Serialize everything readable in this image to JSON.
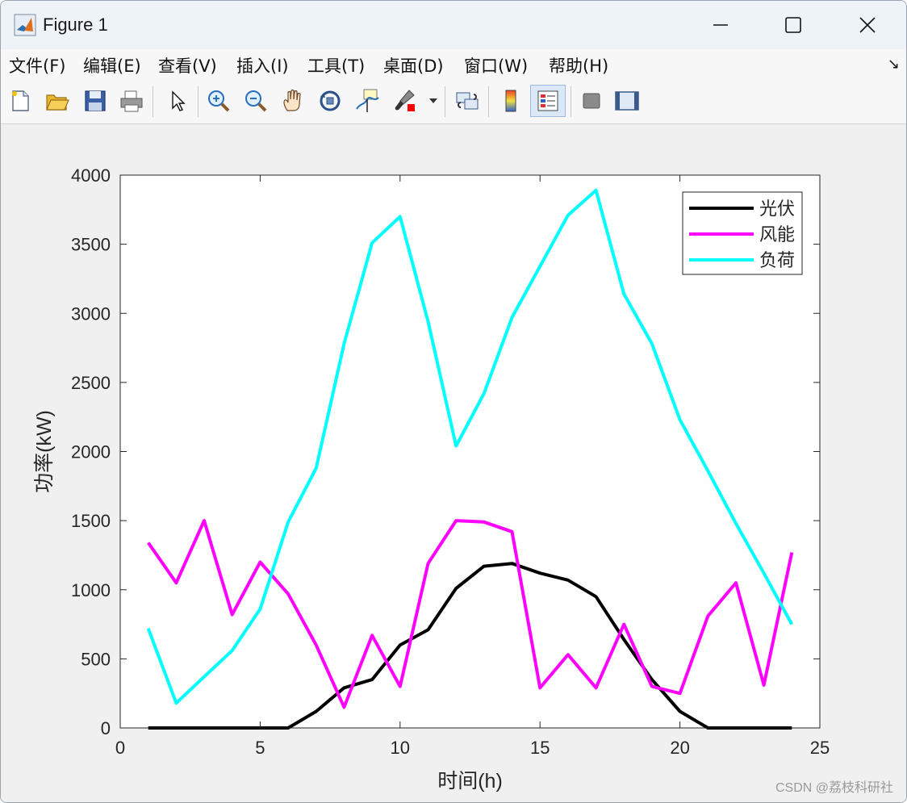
{
  "window": {
    "title": "Figure 1",
    "minimize_glyph": "—",
    "maximize_glyph": "☐",
    "close_glyph": "✕"
  },
  "menu": {
    "items": [
      {
        "label": "文件(F)"
      },
      {
        "label": "编辑(E)"
      },
      {
        "label": "查看(V)"
      },
      {
        "label": "插入(I)"
      },
      {
        "label": "工具(T)"
      },
      {
        "label": "桌面(D)"
      },
      {
        "label": "窗口(W)"
      },
      {
        "label": "帮助(H)"
      }
    ],
    "overflow_glyph": "↘"
  },
  "toolbar": {
    "tools": [
      {
        "icon": "new-figure-icon"
      },
      {
        "icon": "open-file-icon"
      },
      {
        "icon": "save-icon"
      },
      {
        "icon": "print-icon"
      },
      {
        "icon": "pointer-icon"
      },
      {
        "icon": "zoom-in-icon"
      },
      {
        "icon": "zoom-out-icon"
      },
      {
        "icon": "pan-hand-icon"
      },
      {
        "icon": "rotate-3d-icon"
      },
      {
        "icon": "data-cursor-icon"
      },
      {
        "icon": "brush-icon"
      },
      {
        "icon": "link-plot-icon"
      },
      {
        "icon": "colorbar-icon"
      },
      {
        "icon": "legend-icon"
      },
      {
        "icon": "hide-plot-tools-icon"
      },
      {
        "icon": "show-plot-tools-icon"
      }
    ]
  },
  "chart_data": {
    "type": "line",
    "title": "",
    "xlabel": "时间(h)",
    "ylabel": "功率(kW)",
    "xlim": [
      0,
      25
    ],
    "ylim": [
      0,
      4000
    ],
    "xticks": [
      0,
      5,
      10,
      15,
      20,
      25
    ],
    "yticks": [
      0,
      500,
      1000,
      1500,
      2000,
      2500,
      3000,
      3500,
      4000
    ],
    "grid": false,
    "legend_position": "top-right",
    "x": [
      1,
      2,
      3,
      4,
      5,
      6,
      7,
      8,
      9,
      10,
      11,
      12,
      13,
      14,
      15,
      16,
      17,
      18,
      19,
      20,
      21,
      22,
      23,
      24
    ],
    "series": [
      {
        "name": "光伏",
        "color": "#000000",
        "values": [
          0,
          0,
          0,
          0,
          0,
          0,
          120,
          290,
          350,
          600,
          710,
          1010,
          1170,
          1190,
          1120,
          1070,
          950,
          640,
          350,
          120,
          0,
          0,
          0,
          0
        ]
      },
      {
        "name": "风能",
        "color": "#ff00ff",
        "values": [
          1340,
          1050,
          1500,
          820,
          1200,
          970,
          600,
          150,
          670,
          300,
          1190,
          1500,
          1490,
          1420,
          290,
          530,
          290,
          750,
          300,
          250,
          810,
          1050,
          310,
          1270
        ]
      },
      {
        "name": "负荷",
        "color": "#00ffff",
        "values": [
          720,
          180,
          370,
          560,
          860,
          1490,
          1880,
          2780,
          3510,
          3700,
          2940,
          2040,
          2420,
          2970,
          3340,
          3710,
          3890,
          3140,
          2780,
          2230,
          1860,
          1480,
          1120,
          750
        ]
      }
    ]
  },
  "watermark": "CSDN @荔枝科研社"
}
